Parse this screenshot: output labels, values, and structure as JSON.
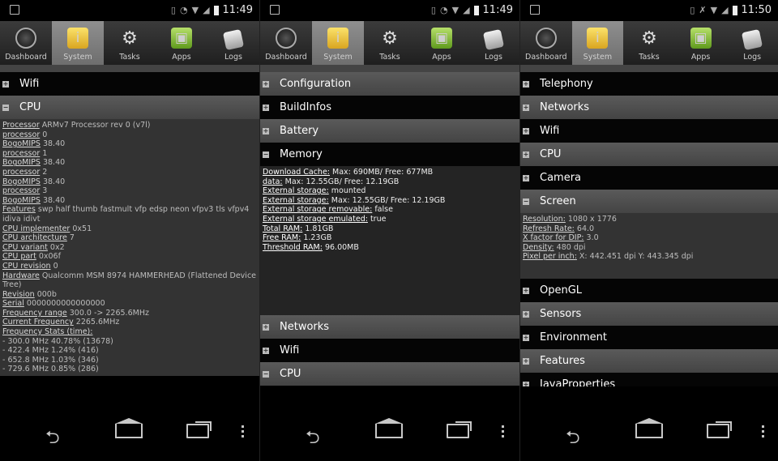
{
  "tabs": [
    {
      "label": "Dashboard",
      "icon": "dashboard-icon"
    },
    {
      "label": "System",
      "icon": "system-icon"
    },
    {
      "label": "Tasks",
      "icon": "tasks-icon"
    },
    {
      "label": "Apps",
      "icon": "apps-icon"
    },
    {
      "label": "Logs",
      "icon": "logs-icon"
    }
  ],
  "panels": [
    {
      "time": "11:49",
      "sections": [
        {
          "label": "Wifi",
          "state": "collapsed",
          "style": "dark"
        },
        {
          "label": "CPU",
          "state": "expanded",
          "style": "grey"
        }
      ],
      "detail": [
        [
          "Processor",
          "ARMv7 Processor rev 0 (v7l)"
        ],
        [
          "processor",
          "0"
        ],
        [
          "BogoMIPS",
          "38.40"
        ],
        [
          "processor",
          "1"
        ],
        [
          "BogoMIPS",
          "38.40"
        ],
        [
          "processor",
          "2"
        ],
        [
          "BogoMIPS",
          "38.40"
        ],
        [
          "processor",
          "3"
        ],
        [
          "BogoMIPS",
          "38.40"
        ],
        [
          "Features",
          "swp half thumb fastmult vfp edsp neon vfpv3 tls vfpv4 idiva idivt"
        ],
        [
          "CPU implementer",
          "0x51"
        ],
        [
          "CPU architecture",
          "7"
        ],
        [
          "CPU variant",
          "0x2"
        ],
        [
          "CPU part",
          "0x06f"
        ],
        [
          "CPU revision",
          "0"
        ],
        [
          "Hardware",
          "Qualcomm MSM 8974 HAMMERHEAD (Flattened Device Tree)"
        ],
        [
          "Revision",
          "000b"
        ],
        [
          "Serial",
          "0000000000000000"
        ],
        [
          "Frequency range",
          "300.0 -> 2265.6MHz"
        ],
        [
          "Current Frequency",
          "2265.6MHz"
        ],
        [
          "Frequency Stats (time)",
          ""
        ],
        [
          "",
          "- 300.0 MHz 40.78% (13678)"
        ],
        [
          "",
          "- 422.4 MHz 1.24% (416)"
        ],
        [
          "",
          "- 652.8 MHz 1.03% (346)"
        ],
        [
          "",
          "- 729.6 MHz 0.85% (286)"
        ]
      ]
    },
    {
      "time": "11:49",
      "sections_top": [
        {
          "label": "Configuration",
          "state": "collapsed",
          "style": "grey"
        },
        {
          "label": "BuildInfos",
          "state": "collapsed",
          "style": "dark"
        },
        {
          "label": "Battery",
          "state": "collapsed",
          "style": "grey"
        },
        {
          "label": "Memory",
          "state": "expanded",
          "style": "dark"
        }
      ],
      "detail": [
        [
          "Download Cache",
          "Max: 690MB/ Free: 677MB"
        ],
        [
          "data",
          "Max: 12.55GB/ Free: 12.19GB"
        ],
        [
          "External storage",
          "mounted"
        ],
        [
          "External storage",
          "Max: 12.55GB/ Free: 12.19GB"
        ],
        [
          "External storage removable",
          "false"
        ],
        [
          "External storage emulated",
          "true"
        ],
        [
          "Total RAM",
          "1.81GB"
        ],
        [
          "Free RAM",
          "1.23GB"
        ],
        [
          "Threshold RAM",
          "96.00MB"
        ]
      ],
      "sections_bottom": [
        {
          "label": "Networks",
          "state": "collapsed",
          "style": "grey"
        },
        {
          "label": "Wifi",
          "state": "collapsed",
          "style": "dark"
        },
        {
          "label": "CPU",
          "state": "expanded",
          "style": "grey"
        }
      ]
    },
    {
      "time": "11:50",
      "sections_top": [
        {
          "label": "Telephony",
          "state": "collapsed",
          "style": "dark"
        },
        {
          "label": "Networks",
          "state": "collapsed",
          "style": "grey"
        },
        {
          "label": "Wifi",
          "state": "collapsed",
          "style": "dark"
        },
        {
          "label": "CPU",
          "state": "collapsed",
          "style": "grey"
        },
        {
          "label": "Camera",
          "state": "collapsed",
          "style": "dark"
        },
        {
          "label": "Screen",
          "state": "expanded",
          "style": "grey"
        }
      ],
      "detail": [
        [
          "Resolution",
          "1080 x 1776"
        ],
        [
          "Refresh Rate",
          "64.0"
        ],
        [
          "X factor for DIP",
          "3.0"
        ],
        [
          "Density",
          "480 dpi"
        ],
        [
          "Pixel per inch",
          "X: 442.451 dpi Y: 443.345 dpi"
        ]
      ],
      "sections_bottom": [
        {
          "label": "OpenGL",
          "state": "collapsed",
          "style": "dark"
        },
        {
          "label": "Sensors",
          "state": "collapsed",
          "style": "grey"
        },
        {
          "label": "Environment",
          "state": "collapsed",
          "style": "dark"
        },
        {
          "label": "Features",
          "state": "collapsed",
          "style": "grey"
        },
        {
          "label": "JavaProperties",
          "state": "collapsed",
          "style": "dark"
        }
      ]
    }
  ],
  "colors": {
    "active_tab": "#7c7c7c",
    "section_grey": "#4d4d4d",
    "detail_bg": "#333333"
  }
}
